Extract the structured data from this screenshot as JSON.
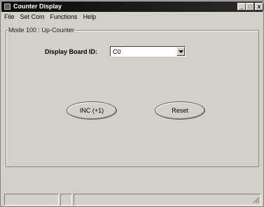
{
  "window": {
    "title": "Counter Display",
    "controls": {
      "minimize": "_",
      "maximize": "□",
      "close": "x"
    }
  },
  "menu": {
    "items": [
      "File",
      "Set Com",
      "Functions",
      "Help"
    ]
  },
  "group": {
    "legend": "Mode 100 : Up-Counter"
  },
  "board": {
    "label": "Display Board ID:",
    "value": "C0"
  },
  "buttons": {
    "increment": "INC (+1)",
    "reset": "Reset"
  },
  "icons": {
    "app": "app-icon",
    "dropdown": "chevron-down-icon",
    "grip": "resize-grip-icon"
  }
}
